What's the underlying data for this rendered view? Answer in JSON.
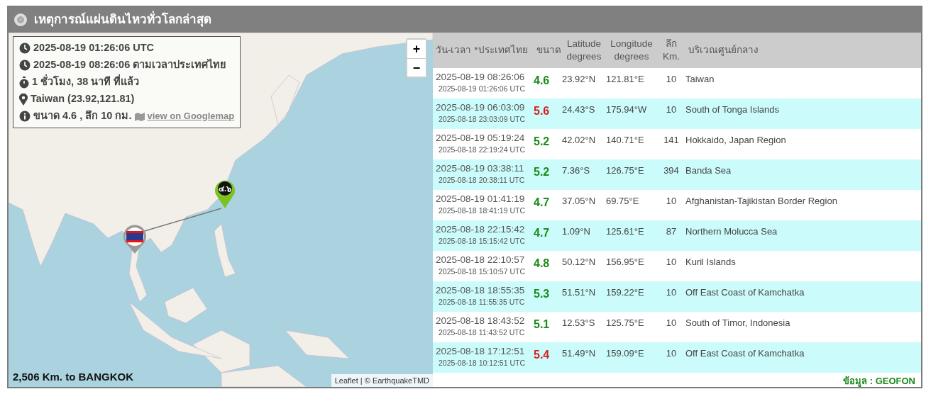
{
  "panel": {
    "title": "เหตุการณ์แผ่นดินไหวทั่วโลกล่าสุด"
  },
  "map": {
    "zoom_in": "+",
    "zoom_out": "−",
    "info": [
      {
        "kind": "clock",
        "text": "2025-08-19 01:26:06 UTC"
      },
      {
        "kind": "clock",
        "text": "2025-08-19 08:26:06 ตามเวลาประเทศไทย"
      },
      {
        "kind": "stopwatch",
        "text": "1 ชั่วโมง, 38 นาที ที่แล้ว"
      },
      {
        "kind": "pin",
        "text": "Taiwan (23.92,121.81)"
      },
      {
        "kind": "info",
        "text": "ขนาด 4.6 , ลึก 10 กม.",
        "link": "view on Googlemap"
      }
    ],
    "marker_label": "๔.๖",
    "distance": "2,506 Km. to BANGKOK",
    "attribution": {
      "leaflet": "Leaflet",
      "separator": "| ©",
      "source": "EarthquakeTMD"
    }
  },
  "table": {
    "columns": [
      "วัน-เวลา *ประเทศไทย",
      "ขนาด",
      "Latitude degrees",
      "Longitude degrees",
      "ลึก Km.",
      "บริเวณศูนย์กลาง"
    ],
    "rows": [
      {
        "local": "2025-08-19 08:26:06",
        "utc": "2025-08-19 01:26:06 UTC",
        "magnitude": "4.6",
        "color": "#1a8a1a",
        "lat": "23.92°N",
        "lon": "121.81°E",
        "depth": "10",
        "region": "Taiwan"
      },
      {
        "local": "2025-08-19 06:03:09",
        "utc": "2025-08-18 23:03:09 UTC",
        "magnitude": "5.6",
        "color": "#d42020",
        "lat": "24.43°S",
        "lon": "175.94°W",
        "depth": "10",
        "region": "South of Tonga Islands"
      },
      {
        "local": "2025-08-19 05:19:24",
        "utc": "2025-08-18 22:19:24 UTC",
        "magnitude": "5.2",
        "color": "#1a8a1a",
        "lat": "42.02°N",
        "lon": "140.71°E",
        "depth": "141",
        "region": "Hokkaido, Japan Region"
      },
      {
        "local": "2025-08-19 03:38:11",
        "utc": "2025-08-18 20:38:11 UTC",
        "magnitude": "5.2",
        "color": "#1a8a1a",
        "lat": "7.36°S",
        "lon": "126.75°E",
        "depth": "394",
        "region": "Banda Sea"
      },
      {
        "local": "2025-08-19 01:41:19",
        "utc": "2025-08-18 18:41:19 UTC",
        "magnitude": "4.7",
        "color": "#1a8a1a",
        "lat": "37.05°N",
        "lon": "69.75°E",
        "depth": "10",
        "region": "Afghanistan-Tajikistan Border Region"
      },
      {
        "local": "2025-08-18 22:15:42",
        "utc": "2025-08-18 15:15:42 UTC",
        "magnitude": "4.7",
        "color": "#1a8a1a",
        "lat": "1.09°N",
        "lon": "125.61°E",
        "depth": "87",
        "region": "Northern Molucca Sea"
      },
      {
        "local": "2025-08-18 22:10:57",
        "utc": "2025-08-18 15:10:57 UTC",
        "magnitude": "4.8",
        "color": "#1a8a1a",
        "lat": "50.12°N",
        "lon": "156.95°E",
        "depth": "10",
        "region": "Kuril Islands"
      },
      {
        "local": "2025-08-18 18:55:35",
        "utc": "2025-08-18 11:55:35 UTC",
        "magnitude": "5.3",
        "color": "#1a8a1a",
        "lat": "51.51°N",
        "lon": "159.22°E",
        "depth": "10",
        "region": "Off East Coast of Kamchatka"
      },
      {
        "local": "2025-08-18 18:43:52",
        "utc": "2025-08-18 11:43:52 UTC",
        "magnitude": "5.1",
        "color": "#1a8a1a",
        "lat": "12.53°S",
        "lon": "125.75°E",
        "depth": "10",
        "region": "South of Timor, Indonesia"
      },
      {
        "local": "2025-08-18 17:12:51",
        "utc": "2025-08-18 10:12:51 UTC",
        "magnitude": "5.4",
        "color": "#d42020",
        "lat": "51.49°N",
        "lon": "159.09°E",
        "depth": "10",
        "region": "Off East Coast of Kamchatka"
      }
    ],
    "source": "ข้อมูล : GEOFON"
  }
}
